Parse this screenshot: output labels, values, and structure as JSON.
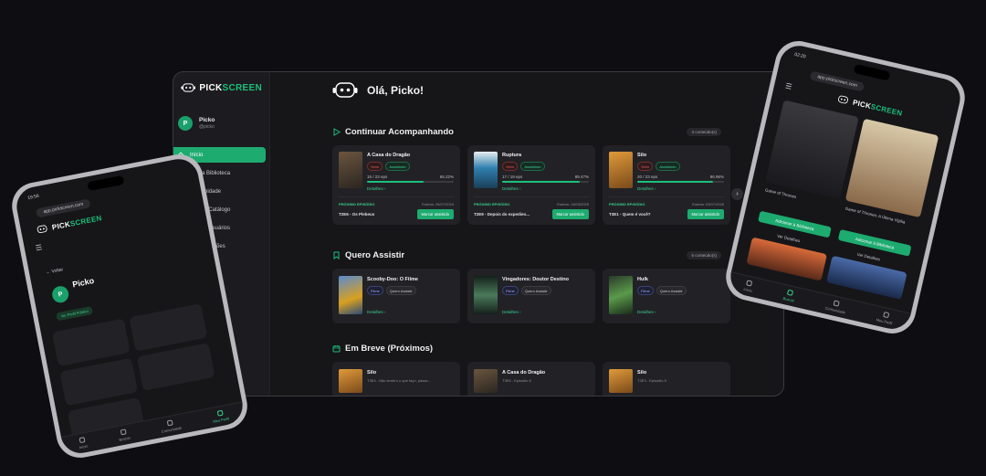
{
  "brand": {
    "logo_pre": "PICK",
    "logo_post": "SCREEN"
  },
  "user": {
    "initial": "P",
    "name": "Picko",
    "handle": "@picko"
  },
  "sidebar": {
    "items": [
      {
        "label": "Início",
        "icon": "home-icon"
      },
      {
        "label": "Minha Biblioteca",
        "icon": "library-icon"
      },
      {
        "label": "Comunidade",
        "icon": "chat-icon"
      },
      {
        "label": "Buscar Catálogo",
        "icon": "search-icon"
      },
      {
        "label": "Buscar Usuários",
        "icon": "users-icon"
      },
      {
        "label": "Configurações",
        "icon": "gear-icon"
      }
    ]
  },
  "greeting": "Olá, Picko!",
  "continuing": {
    "title": "Continuar Acompanhando",
    "count": "3 conteúdo(s)",
    "cards": [
      {
        "title": "A Casa do Dragão",
        "type": "Série",
        "status": "Assistindo",
        "progress_label": "15 / 23 eps",
        "percent_label": "65.22%",
        "percent": 65.22,
        "details": "Detalhes",
        "next_label": "PRÓXIMO EPISÓDIO",
        "next_date": "Estreia: 25/07/2024",
        "next_ep": "T2E6 - Os Plebeus",
        "mark": "Marcar assistido",
        "poster_color": "#5a4a3a"
      },
      {
        "title": "Ruptura",
        "type": "Série",
        "status": "Assistindo",
        "progress_label": "17 / 19 eps",
        "percent_label": "89.47%",
        "percent": 89.47,
        "details": "Detalhes",
        "next_label": "PRÓXIMO EPISÓDIO",
        "next_date": "Estreia: 13/03/2025",
        "next_ep": "T2E9 - Depois do expedien...",
        "mark": "Marcar assistido",
        "poster_color": "#2f7fae"
      },
      {
        "title": "Silo",
        "type": "Série",
        "status": "Assistindo",
        "progress_label": "20 / 23 eps",
        "percent_label": "86.96%",
        "percent": 86.96,
        "details": "Detalhes",
        "next_label": "PRÓXIMO EPISÓDIO",
        "next_date": "Estreia: 03/07/2026",
        "next_ep": "T3E1 - Quem é você?",
        "mark": "Marcar assistido",
        "poster_color": "#c7782a"
      }
    ]
  },
  "want": {
    "title": "Quero Assistir",
    "count": "6 conteúdo(s)",
    "cards": [
      {
        "title": "Scooby-Doo: O Filme",
        "type": "Filme",
        "status": "Quero Assistir",
        "details": "Detalhes",
        "poster_color": "#3a5a8a"
      },
      {
        "title": "Vingadores: Doutor Destino",
        "type": "Filme",
        "status": "Quero Assistir",
        "details": "Detalhes",
        "poster_color": "#2a4a36"
      },
      {
        "title": "Hulk",
        "type": "Filme",
        "status": "Quero Assistir",
        "details": "Detalhes",
        "poster_color": "#3d6a3a"
      }
    ]
  },
  "soon": {
    "title": "Em Breve (Próximos)",
    "cards": [
      {
        "title": "Silo",
        "sub": "T3E4 - Não lembro o que faço, pássa...",
        "poster_color": "#c7782a"
      },
      {
        "title": "A Casa do Dragão",
        "sub": "T3E6 - Episódio 6",
        "poster_color": "#5a4a3a"
      },
      {
        "title": "Silo",
        "sub": "T3E3 - Episódio 5",
        "poster_color": "#c7782a"
      }
    ]
  },
  "left_phone": {
    "time": "19:56",
    "url": "app.pickscreen.com",
    "back": "← Voltar",
    "name": "Picko",
    "stat1": "Ver Perfil Público",
    "nav": [
      "Início",
      "Buscar",
      "Comunidade",
      "Meu Perfil"
    ]
  },
  "right_phone": {
    "time": "02:20",
    "url": "app.pickscreen.com",
    "poster1": "Game of Thrones",
    "poster2": "Game of Thrones: A Última Vigília",
    "btn": "Adicionar à Biblioteca",
    "details": "Ver Detalhes",
    "nav": [
      "Início",
      "Buscar",
      "Comunidade",
      "Meu Perfil"
    ]
  },
  "colors": {
    "accent": "#1dab70",
    "background": "#0e0e12",
    "panel": "#161619"
  }
}
